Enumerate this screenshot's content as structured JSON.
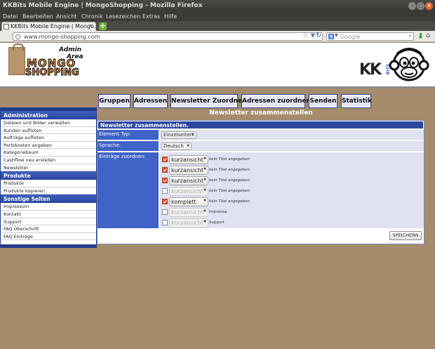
{
  "window": {
    "title": "KKBits Mobile Engine | MongoShopping - Mozilla Firefox",
    "minimize_glyph": "–",
    "maximize_glyph": "□",
    "close_glyph": "×"
  },
  "menubar": [
    "Datei",
    "Bearbeiten",
    "Ansicht",
    "Chronik",
    "Lesezeichen",
    "Extras",
    "Hilfe"
  ],
  "browser": {
    "tab_title": "KKBits Mobile Engine | Mongo...",
    "tab_close": "×",
    "newtab_glyph": "+",
    "url": "www.mongo-shopping.com",
    "search_placeholder": "Google",
    "icons": [
      "globe-icon",
      "star-icon",
      "reload-icon",
      "google-icon",
      "search-icon",
      "download-icon",
      "home-icon"
    ],
    "star_glyph": "☆",
    "reload_glyph": "↻",
    "search_glyph": "⌕",
    "download_glyph": "⬇",
    "home_glyph": "⌂"
  },
  "logo": {
    "admin": "Admin",
    "area": "Area",
    "mongo": "MONGO",
    "shopping": "SHOPPING",
    "kk": "KK",
    "bits": "BITS"
  },
  "topnav": [
    "Gruppen",
    "Adressen",
    "Newsletter Zuordnen",
    "Adressen zuordnen",
    "Senden",
    "Statistik"
  ],
  "sidebar": {
    "sections": [
      {
        "title": "Administration",
        "items": [
          "Dateien und Bilder verwalten",
          "Kunden auflisten",
          "Aufträge auflisten",
          "Portokosten angeben",
          "Kategoriebaum",
          "Cashflow neu erstellen",
          "Newsletter"
        ]
      },
      {
        "title": "Produkte",
        "items": [
          "Produkte",
          "Produkte kopieren"
        ]
      },
      {
        "title": "Sonstige Seiten",
        "items": [
          "Impressum",
          "Kontakt",
          "Support",
          "FAQ Überschrift",
          "FAQ Einträge"
        ]
      }
    ]
  },
  "main": {
    "section_title": "Newsletter zusammenstellen",
    "panel_title": "Newsletter zusammenstellen.",
    "element_type_label": "Element Typ:",
    "element_type_value": "Einzelseiten",
    "language_label": "Sprache:",
    "language_value": "Deutsch",
    "entries_label": "Einträge zuordnen:",
    "caret": "▼",
    "entries": [
      {
        "checked": true,
        "mode": "kurzansicht",
        "enabled": true,
        "description": "kein Titel angegeben"
      },
      {
        "checked": true,
        "mode": "kurzansicht",
        "enabled": true,
        "description": "kein Titel angegeben"
      },
      {
        "checked": true,
        "mode": "kurzansicht",
        "enabled": true,
        "description": "kein Titel angegeben"
      },
      {
        "checked": false,
        "mode": "kurzansicht",
        "enabled": false,
        "description": "kein Titel angegeben"
      },
      {
        "checked": true,
        "mode": "komplett",
        "enabled": true,
        "description": "kein Titel angegeben"
      },
      {
        "checked": false,
        "mode": "kurzansicht",
        "enabled": false,
        "description": "Impressa"
      },
      {
        "checked": false,
        "mode": "kurzansicht",
        "enabled": false,
        "description": "Support"
      }
    ],
    "save_label": "SPEICHERN"
  }
}
